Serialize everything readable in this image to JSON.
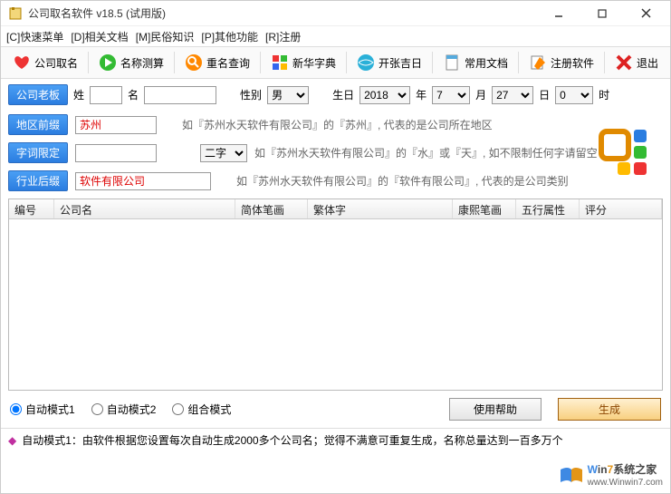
{
  "window": {
    "title": "公司取名软件 v18.5 (试用版)"
  },
  "menu": {
    "c": "[C]快速菜单",
    "d": "[D]相关文档",
    "m": "[M]民俗知识",
    "p": "[P]其他功能",
    "r": "[R]注册"
  },
  "toolbar": {
    "naming": "公司取名",
    "calc": "名称测算",
    "dup": "重名查询",
    "dict": "新华字典",
    "lucky": "开张吉日",
    "docs": "常用文档",
    "reg": "注册软件",
    "exit": "退出"
  },
  "params": {
    "boss_btn": "公司老板",
    "surname_label": "姓",
    "surname_value": "",
    "name_label": "名",
    "name_value": "",
    "gender_label": "性别",
    "gender_value": "男",
    "birth_label": "生日",
    "year": "2018",
    "year_suffix": "年",
    "month": "7",
    "month_suffix": "月",
    "day": "27",
    "day_suffix": "日",
    "hour": "0",
    "hour_suffix": "时"
  },
  "filters": {
    "region_btn": "地区前缀",
    "region_value": "苏州",
    "region_hint": "如『苏州水天软件有限公司』的『苏州』, 代表的是公司所在地区",
    "word_btn": "字词限定",
    "word_value": "",
    "word_count": "二字",
    "word_hint": "如『苏州水天软件有限公司』的『水』或『天』, 如不限制任何字请留空",
    "suffix_btn": "行业后缀",
    "suffix_value": "软件有限公司",
    "suffix_hint": "如『苏州水天软件有限公司』的『软件有限公司』, 代表的是公司类别"
  },
  "table": {
    "col1": "编号",
    "col2": "公司名",
    "col3": "简体笔画",
    "col4": "繁体字",
    "col5": "康熙笔画",
    "col6": "五行属性",
    "col7": "评分"
  },
  "modes": {
    "m1": "自动模式1",
    "m2": "自动模式2",
    "m3": "组合模式",
    "help_btn": "使用帮助",
    "gen_btn": "生成"
  },
  "status": {
    "text": "自动模式1：由软件根据您设置每次自动生成2000多个公司名；觉得不满意可重复生成，名称总量达到一百多万个"
  },
  "watermark": {
    "brand": "Win7系统之家",
    "url": "www.Winwin7.com"
  }
}
